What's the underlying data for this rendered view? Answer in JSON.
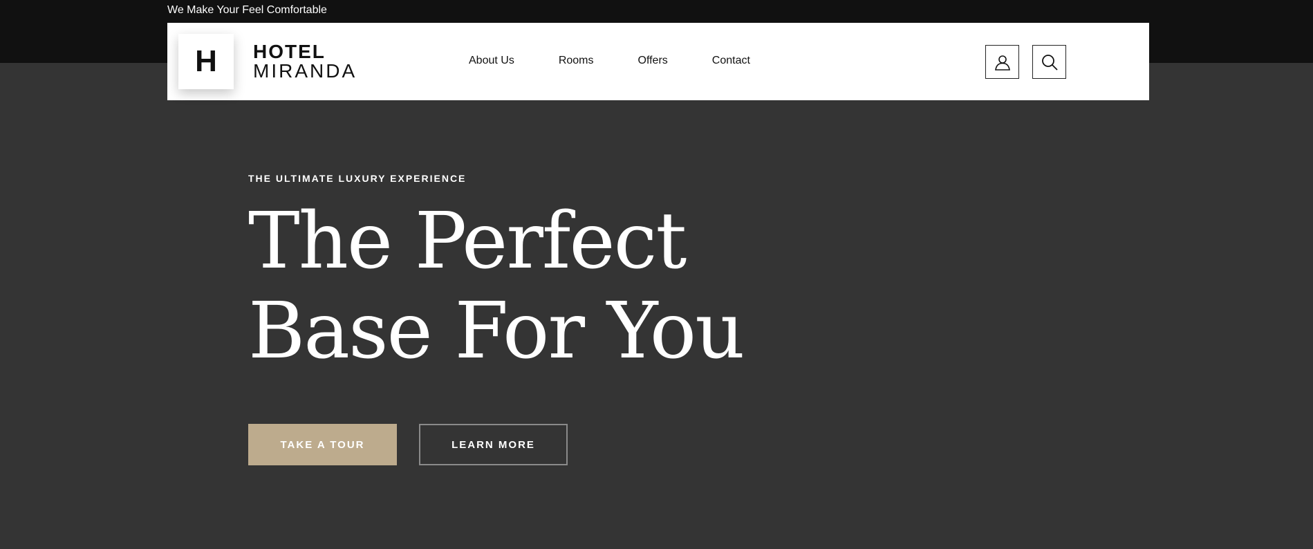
{
  "topbar": {
    "tagline": "We Make Your Feel Comfortable"
  },
  "header": {
    "logo": {
      "letter": "H",
      "line1": "HOTEL",
      "line2": "MIRANDA"
    },
    "nav": [
      {
        "label": "About Us"
      },
      {
        "label": "Rooms"
      },
      {
        "label": "Offers"
      },
      {
        "label": "Contact"
      }
    ],
    "icons": {
      "user": "user-icon",
      "search": "search-icon"
    }
  },
  "hero": {
    "eyebrow": "THE ULTIMATE LUXURY EXPERIENCE",
    "title_line1": "The Perfect",
    "title_line2": "Base For You",
    "buttons": {
      "tour": "TAKE A TOUR",
      "learn": "LEARN MORE"
    }
  },
  "colors": {
    "topbar_bg": "#111111",
    "page_bg": "#343434",
    "accent": "#bdab8d"
  }
}
